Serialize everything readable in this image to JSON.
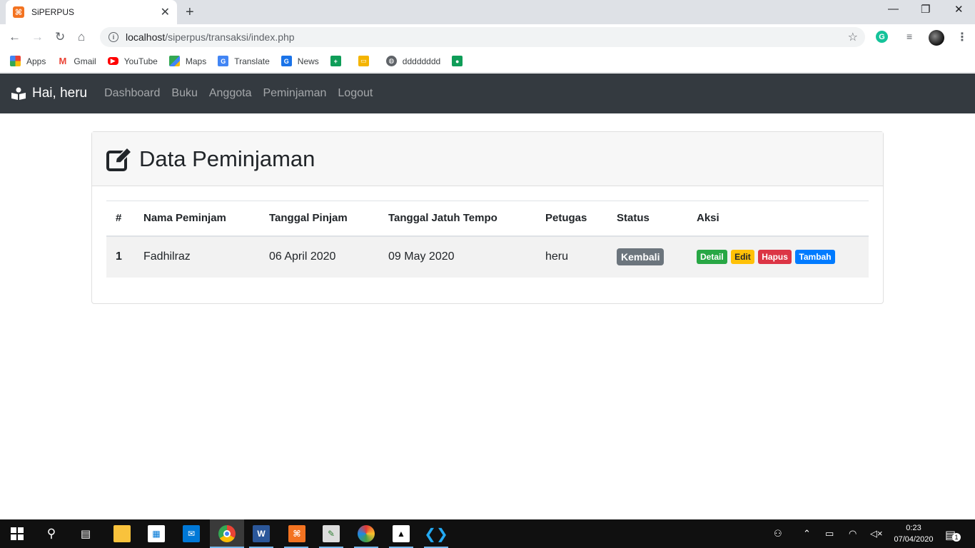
{
  "browser": {
    "tab_title": "SiPERPUS",
    "url_host": "localhost",
    "url_path": "/siperpus/transaksi/index.php",
    "bookmarks": [
      {
        "label": "Apps",
        "icon": "apps-grid-icon",
        "color": "#4285f4"
      },
      {
        "label": "Gmail",
        "icon": "gmail-icon",
        "color": "#ea4335"
      },
      {
        "label": "YouTube",
        "icon": "youtube-icon",
        "color": "#ff0000"
      },
      {
        "label": "Maps",
        "icon": "maps-icon",
        "color": "#34a853"
      },
      {
        "label": "Translate",
        "icon": "translate-icon",
        "color": "#4285f4"
      },
      {
        "label": "News",
        "icon": "news-icon",
        "color": "#1a73e8"
      },
      {
        "label": "",
        "icon": "sheets-icon",
        "color": "#0f9d58"
      },
      {
        "label": "",
        "icon": "slides-icon",
        "color": "#f4b400"
      },
      {
        "label": "dddddddd",
        "icon": "globe-icon",
        "color": "#5f6368"
      },
      {
        "label": "",
        "icon": "classroom-icon",
        "color": "#0f9d58"
      }
    ]
  },
  "navbar": {
    "brand": "Hai, heru",
    "links": [
      "Dashboard",
      "Buku",
      "Anggota",
      "Peminjaman",
      "Logout"
    ]
  },
  "card": {
    "title": "Data Peminjaman",
    "headers": [
      "#",
      "Nama Peminjam",
      "Tanggal Pinjam",
      "Tanggal Jatuh Tempo",
      "Petugas",
      "Status",
      "Aksi"
    ],
    "rows": [
      {
        "num": "1",
        "nama": "Fadhilraz",
        "tgl_pinjam": "06 April 2020",
        "tgl_tempo": "09 May 2020",
        "petugas": "heru",
        "status": "Kembali",
        "actions": [
          "Detail",
          "Edit",
          "Hapus",
          "Tambah"
        ]
      }
    ]
  },
  "taskbar": {
    "time": "0:23",
    "date": "07/04/2020",
    "notification_count": "1"
  },
  "colors": {
    "navbar_bg": "#343a40",
    "status_secondary": "#6c757d",
    "action_detail": "#28a745",
    "action_edit": "#ffc107",
    "action_hapus": "#dc3545",
    "action_tambah": "#007bff"
  }
}
